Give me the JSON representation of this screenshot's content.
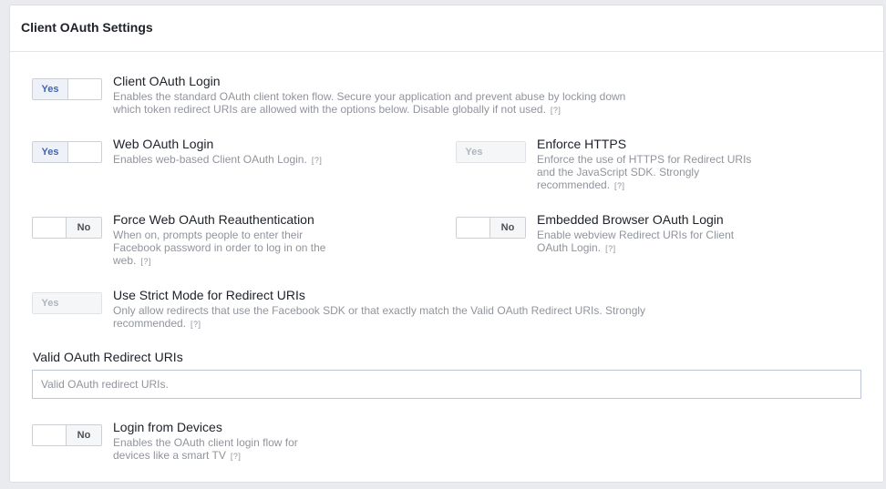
{
  "panel": {
    "title": "Client OAuth Settings"
  },
  "help_label": "[?]",
  "settings": {
    "client_oauth_login": {
      "state": "Yes",
      "title": "Client OAuth Login",
      "desc_line1": "Enables the standard OAuth client token flow. Secure your application and prevent abuse by locking down",
      "desc_line2": "which token redirect URIs are allowed with the options below. Disable globally if not used."
    },
    "web_oauth_login": {
      "state": "Yes",
      "title": "Web OAuth Login",
      "desc_line1": "Enables web-based Client OAuth Login."
    },
    "enforce_https": {
      "state": "Yes",
      "title": "Enforce HTTPS",
      "desc_line1": "Enforce the use of HTTPS for Redirect URIs",
      "desc_line2": "and the JavaScript SDK. Strongly",
      "desc_line3": "recommended."
    },
    "force_reauth": {
      "state": "No",
      "title": "Force Web OAuth Reauthentication",
      "desc_line1": "When on, prompts people to enter their",
      "desc_line2": "Facebook password in order to log in on the",
      "desc_line3": "web."
    },
    "embedded_browser": {
      "state": "No",
      "title": "Embedded Browser OAuth Login",
      "desc_line1": "Enable webview Redirect URIs for Client",
      "desc_line2": "OAuth Login."
    },
    "strict_mode": {
      "state": "Yes",
      "title": "Use Strict Mode for Redirect URIs",
      "desc_line1": "Only allow redirects that use the Facebook SDK or that exactly match the Valid OAuth Redirect URIs. Strongly",
      "desc_line2": "recommended."
    },
    "login_from_devices": {
      "state": "No",
      "title": "Login from Devices",
      "desc_line1": "Enables the OAuth client login flow for",
      "desc_line2": "devices like a smart TV"
    }
  },
  "redirect_uris": {
    "label": "Valid OAuth Redirect URIs",
    "value": "",
    "placeholder": "Valid OAuth redirect URIs."
  }
}
